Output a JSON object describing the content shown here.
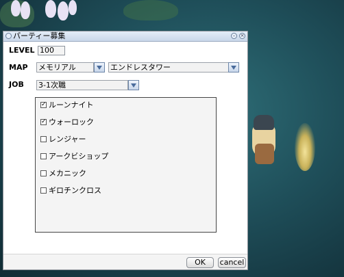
{
  "window": {
    "title": "パーティー募集"
  },
  "form": {
    "level_label": "LEVEL",
    "level_value": "100",
    "map_label": "MAP",
    "map_region": "メモリアル",
    "map_dungeon": "エンドレスタワー",
    "job_label": "JOB",
    "job_class": "3-1次職"
  },
  "jobs": [
    {
      "label": "ルーンナイト",
      "checked": true
    },
    {
      "label": "ウォーロック",
      "checked": true
    },
    {
      "label": "レンジャー",
      "checked": false
    },
    {
      "label": "アークビショップ",
      "checked": false
    },
    {
      "label": "メカニック",
      "checked": false
    },
    {
      "label": "ギロチンクロス",
      "checked": false
    }
  ],
  "buttons": {
    "ok": "OK",
    "cancel": "cancel"
  },
  "icons": {
    "minimize": "minimize-icon",
    "close": "close-icon",
    "window": "window-icon",
    "dropdown": "chevron-down-icon"
  }
}
